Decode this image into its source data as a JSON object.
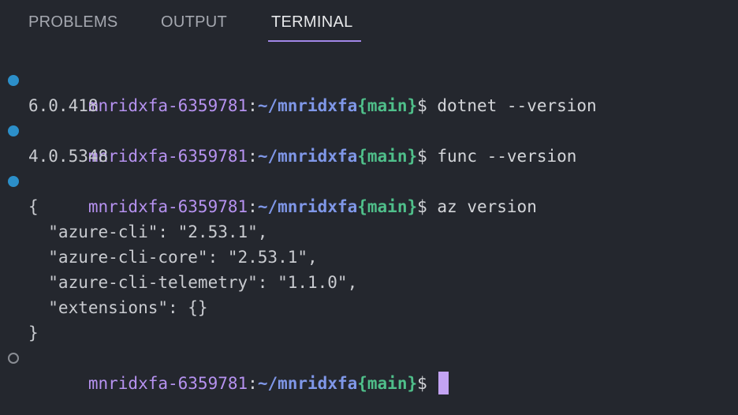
{
  "tabs": [
    {
      "label": "PROBLEMS"
    },
    {
      "label": "OUTPUT"
    },
    {
      "label": "TERMINAL",
      "active": true
    }
  ],
  "colors": {
    "background": "#24272e",
    "accent": "#a187e8",
    "user": "#b692f0",
    "path": "#7f97e8",
    "branch": "#4fbf8a",
    "status_dot_success": "#2c8fc9",
    "cursor": "#c3a3f3"
  },
  "prompt": {
    "user_host": "mnridxfa-6359781",
    "colon": ":",
    "path": "~/mnridxfa",
    "branch": "{main}",
    "sign": "$ "
  },
  "terminal": {
    "cmd1": "dotnet --version",
    "out1": "6.0.418",
    "cmd2": "func --version",
    "out2": "4.0.5348",
    "cmd3": "az version",
    "json_lines": [
      "{",
      "  \"azure-cli\": \"2.53.1\",",
      "  \"azure-cli-core\": \"2.53.1\",",
      "  \"azure-cli-telemetry\": \"1.1.0\",",
      "  \"extensions\": {}",
      "}"
    ]
  }
}
